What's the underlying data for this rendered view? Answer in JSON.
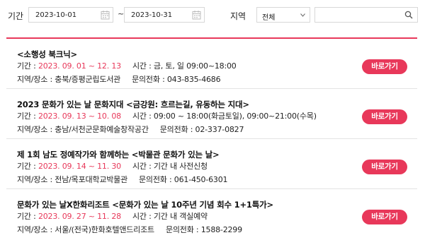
{
  "filters": {
    "period_label": "기간",
    "start_date": "2023-10-01",
    "tilde": "~",
    "end_date": "2023-10-31",
    "region_label": "지역",
    "region_selected": "전체",
    "search_value": ""
  },
  "events": [
    {
      "title": "<소행성 북크닉>",
      "period_label": "기간 : ",
      "period": "2023. 09. 01 ~ 12. 13",
      "time_label": "시간 : ",
      "time": "금, 토, 일 09:00~18:00",
      "place_label": "지역/장소 : ",
      "place": "충북/증평군립도서관",
      "phone_label": "문의전화 : ",
      "phone": "043-835-4686",
      "button": "바로가기"
    },
    {
      "title": "2023 문화가 있는 날 문화지대 <금강원: 흐르는길, 유동하는 지대>",
      "period_label": "기간 : ",
      "period": "2023. 09. 13 ~ 10. 08",
      "time_label": "시간 : ",
      "time": "09:00 ~ 18:00(화금토일), 09:00~21:00(수목)",
      "place_label": "지역/장소 : ",
      "place": "충남/서천군문화예술창작공간",
      "phone_label": "문의전화 : ",
      "phone": "02-337-0827",
      "button": "바로가기"
    },
    {
      "title": "제 1회 남도 정예작가와 함께하는 <박물관 문화가 있는 날>",
      "period_label": "기간 : ",
      "period": "2023. 09. 14 ~ 11. 30",
      "time_label": "시간 : ",
      "time": "기간 내 사전신청",
      "place_label": "지역/장소 : ",
      "place": "전남/목포대학교박물관",
      "phone_label": "문의전화 : ",
      "phone": "061-450-6301",
      "button": "바로가기"
    },
    {
      "title": "문화가 있는 날X한화리조트 <문화가 있는 날 10주년 기념 회수 1+1특가>",
      "period_label": "기간 : ",
      "period": "2023. 09. 27 ~ 11. 28",
      "time_label": "시간 : ",
      "time": "기간 내 객실예약",
      "place_label": "지역/장소 : ",
      "place": "서울/(전국)한화호텔앤드리조트",
      "phone_label": "문의전화 : ",
      "phone": "1588-2299",
      "button": "바로가기"
    }
  ],
  "colors": {
    "accent": "#e8385a",
    "border": "#d8d8d8"
  },
  "icons": {
    "calendar": "calendar-icon",
    "search": "search-icon",
    "dropdown": "chevron-down-icon"
  }
}
